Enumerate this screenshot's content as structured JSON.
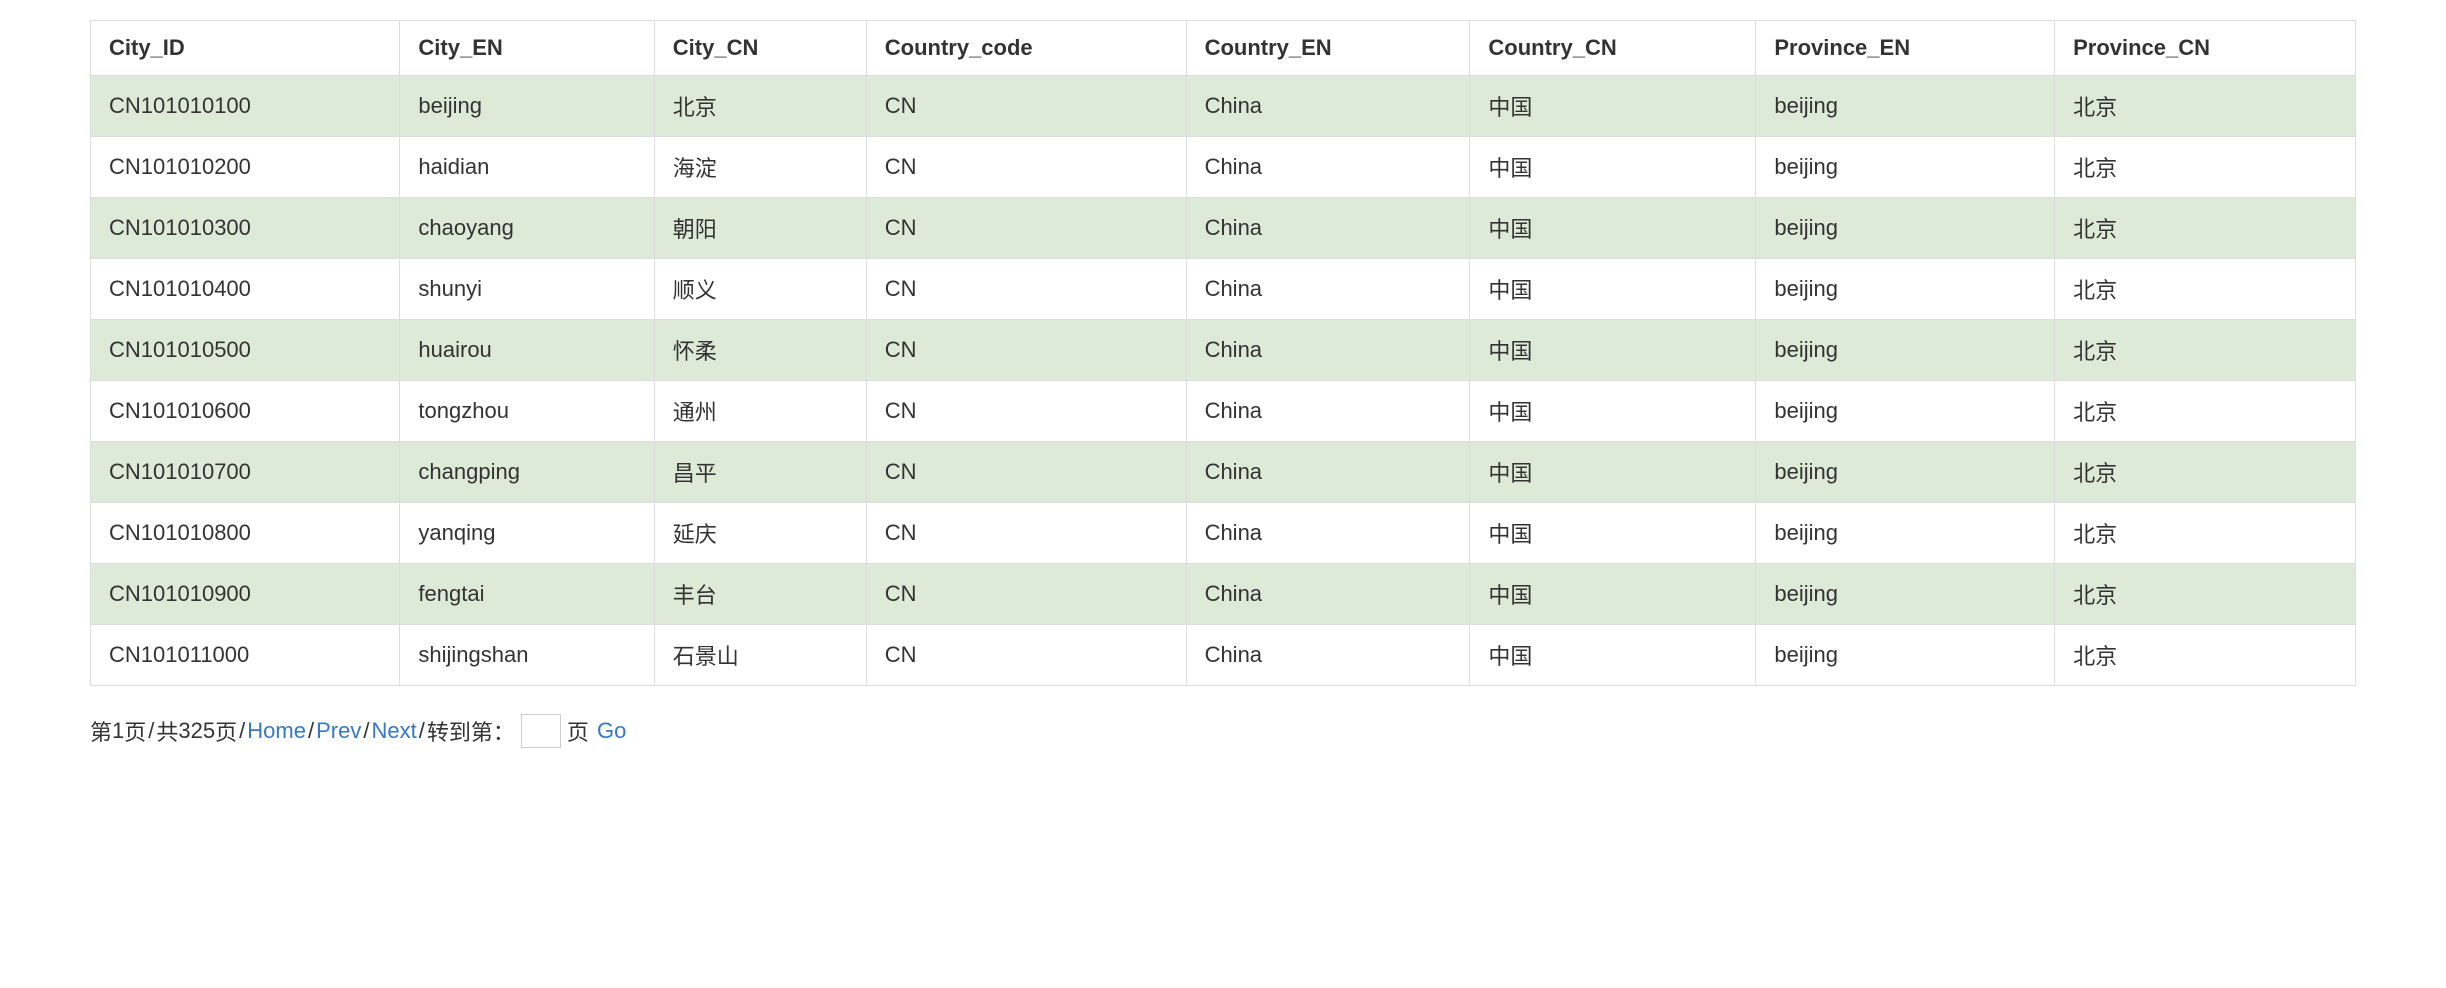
{
  "table": {
    "headers": [
      "City_ID",
      "City_EN",
      "City_CN",
      "Country_code",
      "Country_EN",
      "Country_CN",
      "Province_EN",
      "Province_CN"
    ],
    "rows": [
      [
        "CN101010100",
        "beijing",
        "北京",
        "CN",
        "China",
        "中国",
        "beijing",
        "北京"
      ],
      [
        "CN101010200",
        "haidian",
        "海淀",
        "CN",
        "China",
        "中国",
        "beijing",
        "北京"
      ],
      [
        "CN101010300",
        "chaoyang",
        "朝阳",
        "CN",
        "China",
        "中国",
        "beijing",
        "北京"
      ],
      [
        "CN101010400",
        "shunyi",
        "顺义",
        "CN",
        "China",
        "中国",
        "beijing",
        "北京"
      ],
      [
        "CN101010500",
        "huairou",
        "怀柔",
        "CN",
        "China",
        "中国",
        "beijing",
        "北京"
      ],
      [
        "CN101010600",
        "tongzhou",
        "通州",
        "CN",
        "China",
        "中国",
        "beijing",
        "北京"
      ],
      [
        "CN101010700",
        "changping",
        "昌平",
        "CN",
        "China",
        "中国",
        "beijing",
        "北京"
      ],
      [
        "CN101010800",
        "yanqing",
        "延庆",
        "CN",
        "China",
        "中国",
        "beijing",
        "北京"
      ],
      [
        "CN101010900",
        "fengtai",
        "丰台",
        "CN",
        "China",
        "中国",
        "beijing",
        "北京"
      ],
      [
        "CN101011000",
        "shijingshan",
        "石景山",
        "CN",
        "China",
        "中国",
        "beijing",
        "北京"
      ]
    ]
  },
  "pagination": {
    "current_prefix": "第",
    "current_page": "1",
    "current_suffix": "页",
    "total_prefix": "共",
    "total_pages": "325",
    "total_suffix": "页",
    "home": "Home",
    "prev": "Prev",
    "next": "Next",
    "goto_label": "转到第：",
    "page_unit": "页",
    "go": "Go",
    "input_value": ""
  }
}
